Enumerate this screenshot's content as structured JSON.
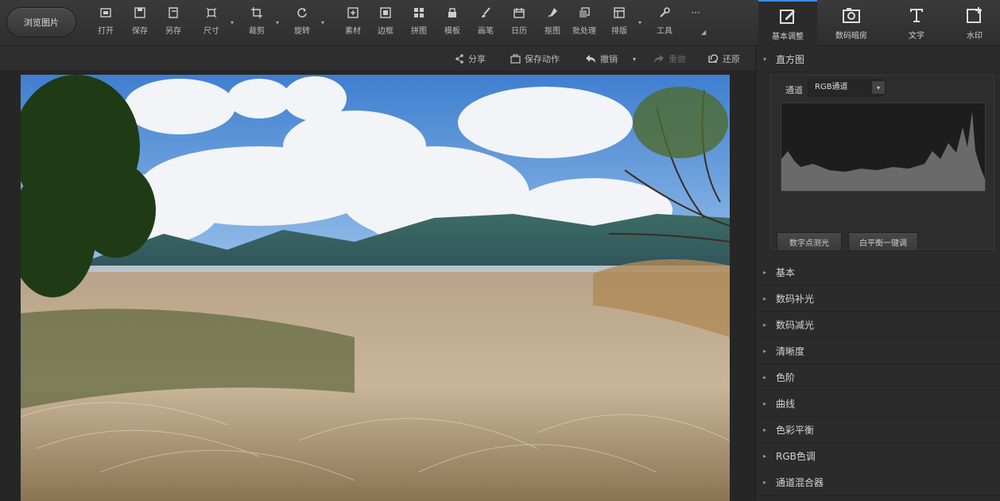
{
  "browse_button": "浏览图片",
  "toolbar": [
    {
      "label": "打开",
      "icon": "open-icon"
    },
    {
      "label": "保存",
      "icon": "save-icon"
    },
    {
      "label": "另存",
      "icon": "save-as-icon"
    },
    {
      "label": "尺寸",
      "icon": "resize-icon"
    },
    {
      "label": "裁剪",
      "icon": "crop-icon"
    },
    {
      "label": "旋转",
      "icon": "rotate-icon"
    },
    {
      "label": "素材",
      "icon": "material-icon"
    },
    {
      "label": "边框",
      "icon": "border-icon"
    },
    {
      "label": "拼图",
      "icon": "collage-icon"
    },
    {
      "label": "模板",
      "icon": "template-icon"
    },
    {
      "label": "画笔",
      "icon": "brush-icon"
    },
    {
      "label": "日历",
      "icon": "calendar-icon"
    },
    {
      "label": "抠图",
      "icon": "cutout-icon"
    },
    {
      "label": "批处理",
      "icon": "batch-icon"
    },
    {
      "label": "排版",
      "icon": "layout-icon"
    },
    {
      "label": "工具",
      "icon": "tools-icon"
    },
    {
      "label": "···",
      "icon": "more-icon"
    }
  ],
  "tabs": [
    {
      "label": "基本调整",
      "icon": "basic-adjust-icon",
      "active": true
    },
    {
      "label": "数码暗房",
      "icon": "darkroom-icon",
      "active": false
    },
    {
      "label": "文字",
      "icon": "text-icon",
      "active": false
    },
    {
      "label": "水印",
      "icon": "watermark-icon",
      "active": false
    }
  ],
  "actions": {
    "share": "分享",
    "save_action": "保存动作",
    "undo": "撤销",
    "redo": "重做",
    "restore": "还原"
  },
  "panel": {
    "histogram_title": "直方图",
    "channel_label": "通道",
    "channel_value": "RGB通道",
    "auto_exposure": "数字点测光",
    "white_balance": "白平衡一键调",
    "sections": [
      "基本",
      "数码补光",
      "数码减光",
      "清晰度",
      "色阶",
      "曲线",
      "色彩平衡",
      "RGB色调",
      "通道混合器"
    ]
  },
  "colors": {
    "accent": "#3a8ee6",
    "bg_dark": "#2b2b2b",
    "toolbar_bg": "#353535"
  }
}
